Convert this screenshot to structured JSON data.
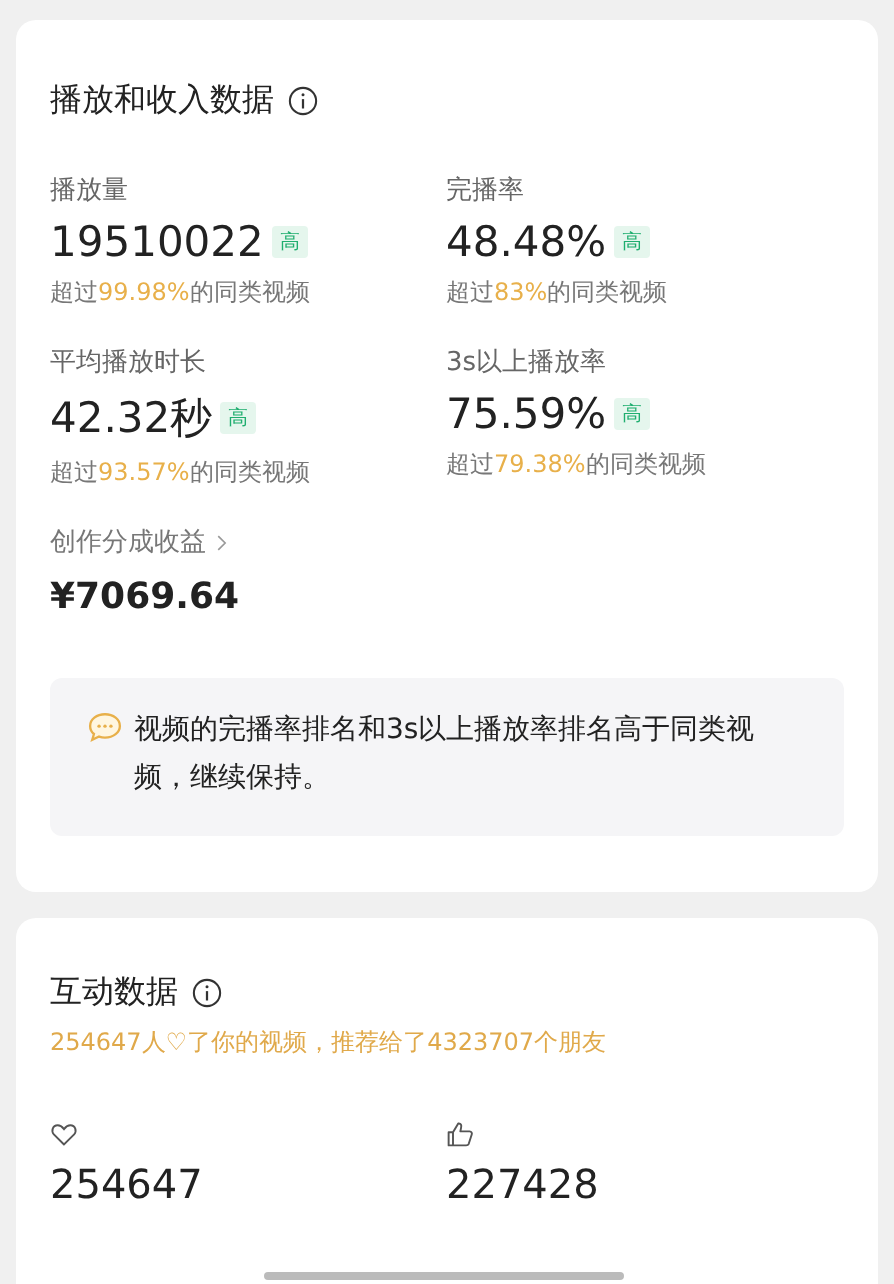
{
  "playback_card": {
    "title": "播放和收入数据",
    "metrics": [
      {
        "label": "播放量",
        "value": "19510022",
        "badge": "高",
        "comparison": "超过**99.98%**的同类视频"
      },
      {
        "label": "完播率",
        "value": "48.48%",
        "badge": "高",
        "comparison": "超过**83%**的同类视频"
      },
      {
        "label": "平均播放时长",
        "value": "42.32秒",
        "badge": "高",
        "comparison": "超过**93.57%**的同类视频"
      },
      {
        "label": "3s以上播放率",
        "value": "75.59%",
        "badge": "高",
        "comparison": "超过**79.38%**的同类视频"
      }
    ],
    "income": {
      "label": "创作分成收益",
      "value": "¥7069.64"
    },
    "tip": "视频的完播率排名和3s以上播放率排名高于同类视频，继续保持。"
  },
  "interaction_card": {
    "title": "互动数据",
    "summary": "254647人♡了你的视频，推荐给了4323707个朋友",
    "stats": [
      {
        "kind": "heart",
        "value": "254647"
      },
      {
        "kind": "thumb",
        "value": "227428"
      }
    ]
  }
}
